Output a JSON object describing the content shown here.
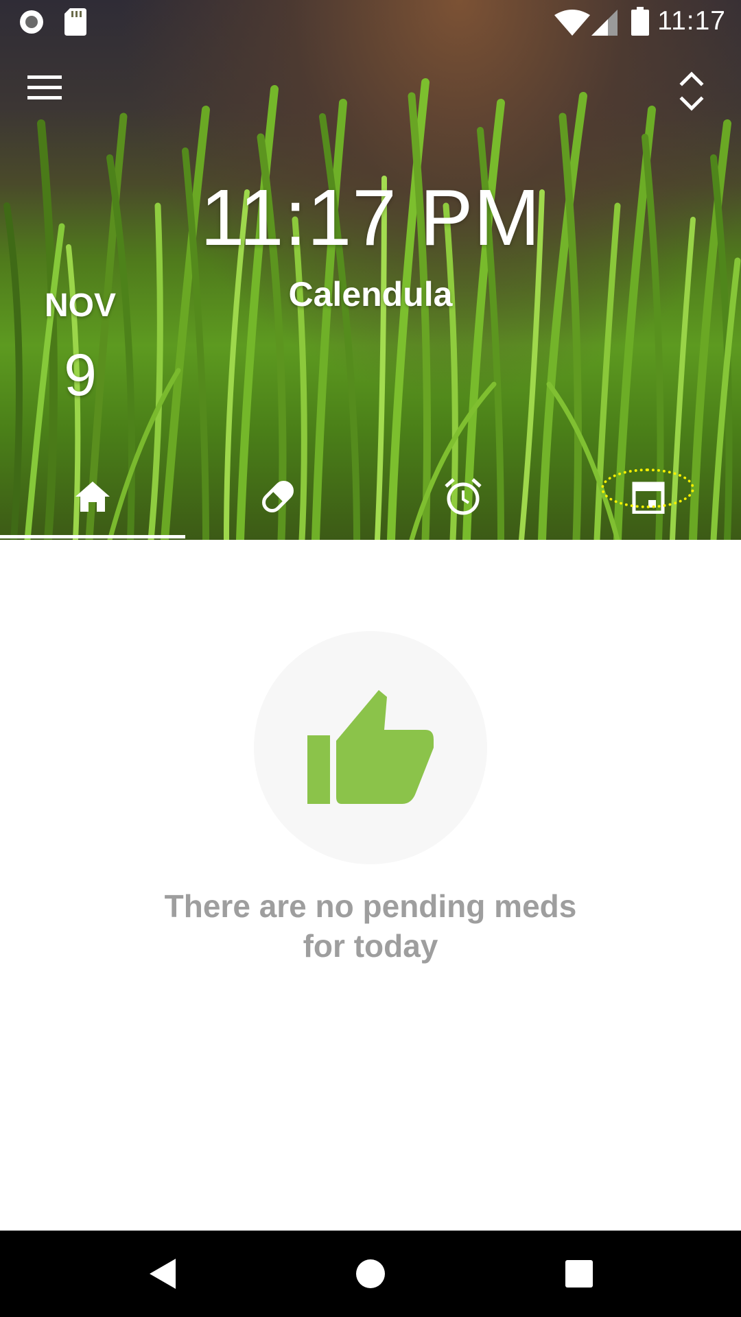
{
  "status_bar": {
    "time": "11:17",
    "left_icons": [
      "record-icon",
      "sd-card-icon"
    ],
    "right_icons": [
      "wifi-icon",
      "cell-signal-icon",
      "battery-icon"
    ]
  },
  "toolbar": {
    "menu_icon": "hamburger-menu-icon",
    "expand_icon": "expand-collapse-icon"
  },
  "header": {
    "time": "11:17 PM",
    "user_name": "Calendula",
    "date_month": "NOV",
    "date_day": "9"
  },
  "tabs": [
    {
      "name": "home",
      "icon": "home-icon",
      "selected": true
    },
    {
      "name": "medicines",
      "icon": "pill-icon",
      "selected": false
    },
    {
      "name": "alarms",
      "icon": "alarm-clock-icon",
      "selected": false
    },
    {
      "name": "calendar",
      "icon": "calendar-icon",
      "selected": false,
      "highlighted": true
    }
  ],
  "empty_state": {
    "icon": "thumbs-up-icon",
    "line1": "There are no pending meds",
    "line2": "for today"
  },
  "nav_bar": {
    "icons": [
      "back-icon",
      "home-circle-icon",
      "recents-icon"
    ]
  },
  "colors": {
    "accent_green": "#8bc34a",
    "highlight_yellow": "#f6f000",
    "empty_text_grey": "#9e9e9e"
  }
}
